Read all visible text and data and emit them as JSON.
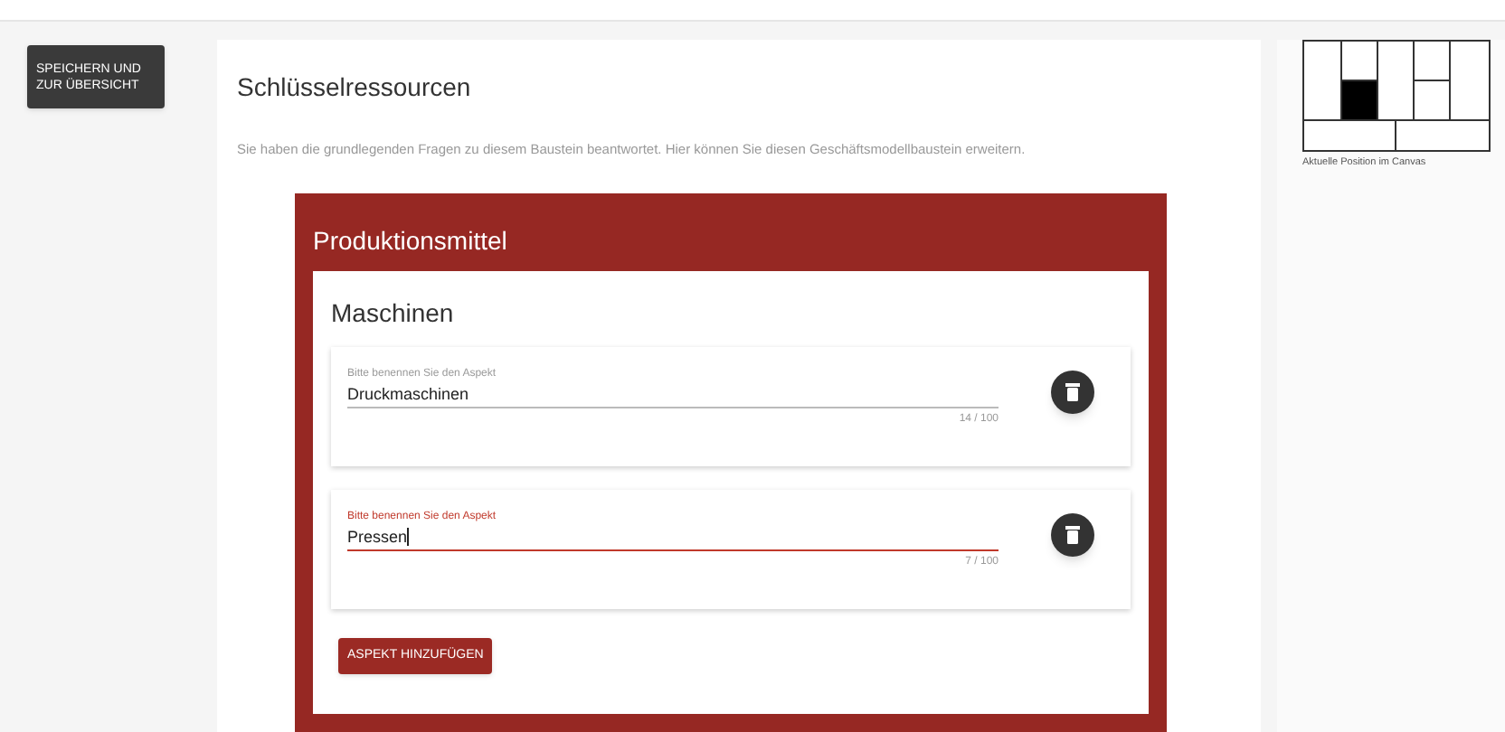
{
  "save_button": "SPEICHERN UND ZUR ÜBERSICHT",
  "title": "Schlüsselressourcen",
  "intro": "Sie haben die grundlegenden Fragen zu diesem Baustein beantwortet. Hier können Sie diesen Geschäftsmodellbaustein erweitern.",
  "section": {
    "title": "Produktionsmittel",
    "group": {
      "title": "Maschinen",
      "aspects": [
        {
          "label": "Bitte benennen Sie den Aspekt",
          "value": "Druckmaschinen",
          "counter": "14 / 100",
          "focused": false
        },
        {
          "label": "Bitte benennen Sie den Aspekt",
          "value": "Pressen",
          "counter": "7 / 100",
          "focused": true
        }
      ],
      "add_button": "ASPEKT HINZUFÜGEN"
    }
  },
  "canvas": {
    "caption": "Aktuelle Position im Canvas",
    "cells": [
      {
        "selected": false
      },
      {
        "selected": false
      },
      {
        "selected": true
      },
      {
        "selected": false
      },
      {
        "selected": false
      },
      {
        "selected": false
      },
      {
        "selected": false
      },
      {
        "selected": false
      },
      {
        "selected": false
      }
    ]
  }
}
